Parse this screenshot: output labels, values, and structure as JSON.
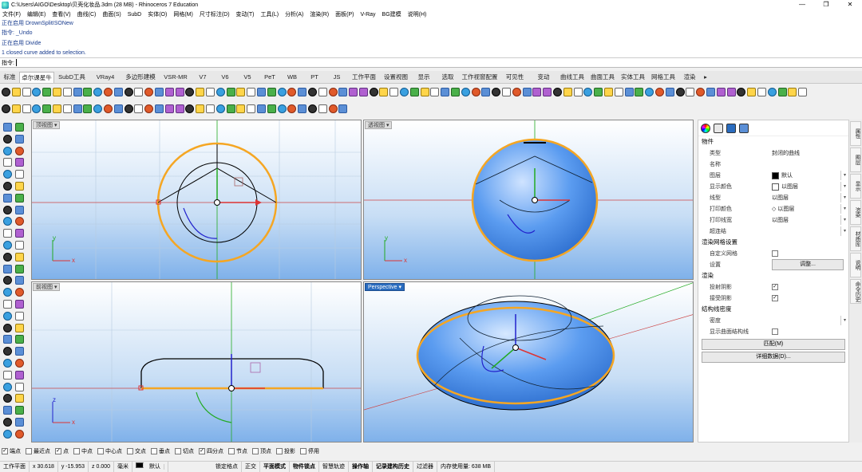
{
  "window": {
    "title": "C:\\Users\\AIGO\\Desktop\\贝壳化妆品.3dm (28 MB) - Rhinoceros 7 Education",
    "controls": [
      "—",
      "❐",
      "✕"
    ]
  },
  "menu": [
    "文件(F)",
    "编辑(E)",
    "查看(V)",
    "曲线(C)",
    "曲面(S)",
    "SubD",
    "实体(O)",
    "网格(M)",
    "尺寸标注(D)",
    "变动(T)",
    "工具(L)",
    "分析(A)",
    "渲染(R)",
    "面板(P)",
    "V-Ray",
    "BG建模",
    "说明(H)"
  ],
  "command_history": [
    "正在启用 DrownSplitISONew",
    "指令: _Undo",
    "正在启用 Divide",
    "1 closed curve added to selection."
  ],
  "command_prompt": "指令:",
  "tabs": [
    "标准",
    "卓尔课星牛",
    "SubD工具",
    "VRay4",
    "多边形建模",
    "VSR-MR",
    "V7",
    "V6",
    "V5",
    "PeT",
    "WB",
    "PT",
    "JS",
    "工作平面",
    "设置视图",
    "显示",
    "选取",
    "工作视窗配置",
    "可见性",
    "变动",
    "曲线工具",
    "曲面工具",
    "实体工具",
    "网格工具",
    "渲染"
  ],
  "tab_more": "▸",
  "active_tab": 1,
  "viewports": {
    "top": "顶视图",
    "perspective_view": "透视图",
    "front": "前视图",
    "perspective": "Perspective"
  },
  "axis_labels": {
    "x": "x",
    "y": "y",
    "z": "z"
  },
  "panel": {
    "section_object": "物件",
    "rows": [
      {
        "k": "类型",
        "v": "封闭的曲线"
      },
      {
        "k": "名称",
        "v": ""
      },
      {
        "k": "图层",
        "v": "默认",
        "swatch": "#000000",
        "dd": true
      },
      {
        "k": "显示颜色",
        "v": "以图层",
        "swatch": "#ffffff",
        "dd": true
      },
      {
        "k": "线型",
        "v": "以图层",
        "dd": true
      },
      {
        "k": "打印颜色",
        "v": "◇ 以图层",
        "dd": true
      },
      {
        "k": "打印线宽",
        "v": "以图层",
        "dd": true
      },
      {
        "k": "超连结",
        "v": "",
        "dd": true
      }
    ],
    "section_render_mesh": "渲染网格设置",
    "custom_mesh": "自定义网格",
    "settings": "设置",
    "adjust_btn": "调整...",
    "section_render": "渲染",
    "cast_shadow": "投射阴影",
    "receive_shadow": "接受阴影",
    "section_isocurve": "结构线密度",
    "density": "密度",
    "show_iso": "显示曲面结构线",
    "match_btn": "匹配(M)",
    "details_btn": "详细数据(D)..."
  },
  "right_tabs": [
    "属性",
    "图层",
    "显示",
    "渲染",
    "材质库",
    "说明",
    "命令历史"
  ],
  "osnap": [
    {
      "label": "端点",
      "on": true
    },
    {
      "label": "最近点",
      "on": false
    },
    {
      "label": "点",
      "on": true
    },
    {
      "label": "中点",
      "on": false
    },
    {
      "label": "中心点",
      "on": false
    },
    {
      "label": "交点",
      "on": false
    },
    {
      "label": "垂点",
      "on": false
    },
    {
      "label": "切点",
      "on": false
    },
    {
      "label": "四分点",
      "on": true
    },
    {
      "label": "节点",
      "on": false
    },
    {
      "label": "顶点",
      "on": false
    },
    {
      "label": "投影",
      "on": false
    },
    {
      "label": "停用",
      "on": false
    }
  ],
  "status": {
    "cplane": "工作平面",
    "x": "x 30.618",
    "y": "y -15.953",
    "z": "z 0.000",
    "units": "毫米",
    "layer": "默认",
    "grid_snap": "锁定格点",
    "ortho": "正交",
    "planar": "平面模式",
    "osnap": "物件锁点",
    "smarttrack": "智慧轨迹",
    "gumball": "操作轴",
    "history": "记录建构历史",
    "filter": "过滤器",
    "memory": "内存使用量: 638 MB"
  },
  "colors": {
    "accent": "#2a6cbf",
    "selected_curve": "#f5a623",
    "surface_blue": "#5b9cf0",
    "x_axis": "#d23030",
    "y_axis": "#2aa02a",
    "z_axis": "#2233cc"
  }
}
